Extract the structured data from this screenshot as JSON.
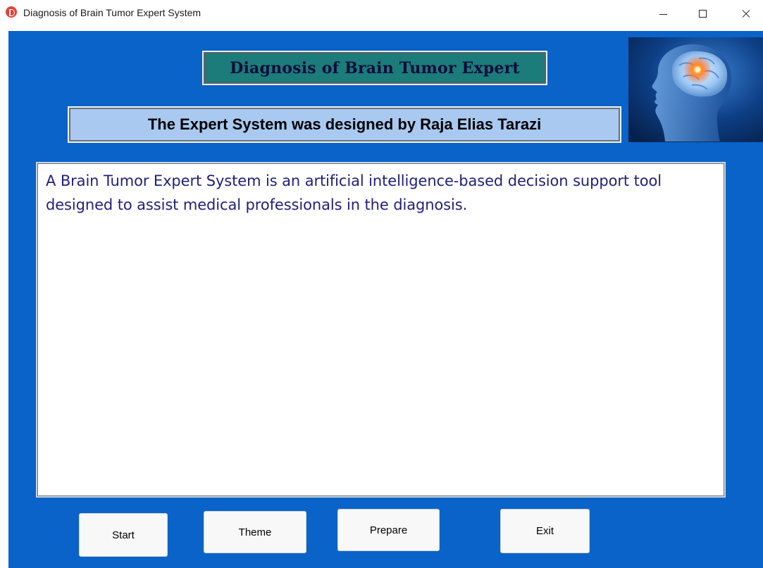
{
  "window": {
    "title": "Diagnosis of Brain Tumor Expert System",
    "app_icon": "red-circle-d-icon",
    "controls": [
      "minimize-icon",
      "maximize-icon",
      "close-icon"
    ]
  },
  "header": {
    "title": "Diagnosis of Brain Tumor Expert",
    "designer": "The Expert System was designed by Raja Elias Tarazi"
  },
  "description": {
    "text": "A Brain Tumor Expert System is an artificial intelligence-based decision support tool designed to assist medical professionals in the diagnosis."
  },
  "buttons": {
    "start": "Start",
    "theme": "Theme",
    "prepare": "Prepare",
    "exit": "Exit"
  },
  "colors": {
    "background": "#0a63c8",
    "heading_box": "#1b7c7a",
    "designer_box": "#a9c9f0",
    "description_text": "#1f1f7a"
  }
}
